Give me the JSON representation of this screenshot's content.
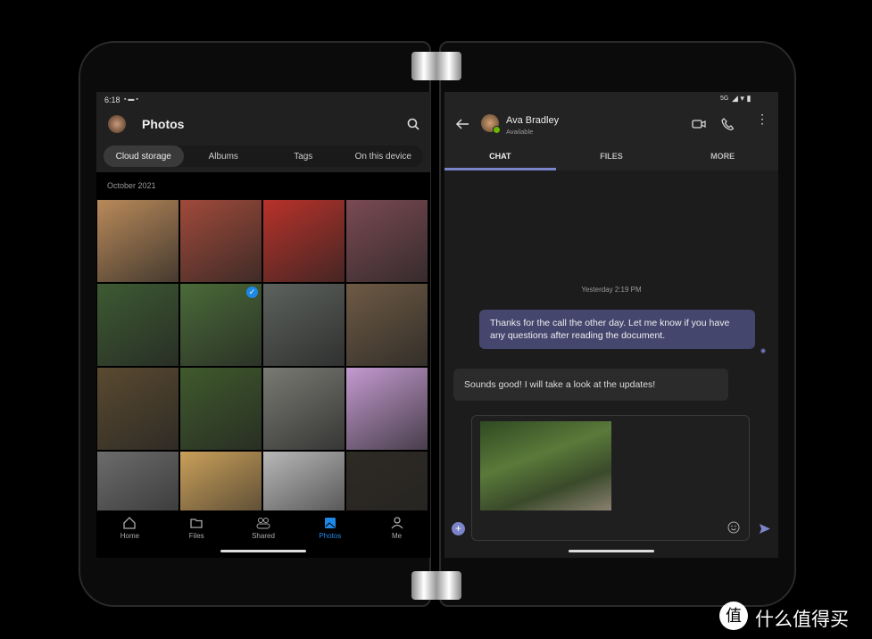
{
  "left": {
    "status_time": "6:18",
    "title": "Photos",
    "tabs": [
      "Cloud storage",
      "Albums",
      "Tags",
      "On this device"
    ],
    "section": "October 2021",
    "photos": [
      "#b98a5a",
      "#a04a3a",
      "#b8322a",
      "#7a4a52",
      "#3d5a32",
      "#4a6a38",
      "#5d625e",
      "#6e5a44",
      "#5a4a30",
      "#3f5a2c",
      "#7a7a74",
      "#c49ad0",
      "#6c6c6c",
      "#caa05a",
      "#b8b8b8",
      "#2e2a24"
    ],
    "nav": [
      {
        "label": "Home",
        "icon": "home-icon"
      },
      {
        "label": "Files",
        "icon": "folder-icon"
      },
      {
        "label": "Shared",
        "icon": "people-icon"
      },
      {
        "label": "Photos",
        "icon": "photos-icon"
      },
      {
        "label": "Me",
        "icon": "person-icon"
      }
    ],
    "active_nav": 3,
    "accent": "#1e88e5"
  },
  "right": {
    "status": "5G",
    "contact": "Ava Bradley",
    "presence": "Available",
    "tabs": [
      "CHAT",
      "FILES",
      "MORE"
    ],
    "timestamp": "Yesterday 2:19 PM",
    "sent": "Thanks for the call the other day. Let me know if you have any questions after reading the document.",
    "received": "Sounds good! I will take a look at the updates!",
    "accent": "#7b83c9"
  },
  "watermark": "什么值得买"
}
